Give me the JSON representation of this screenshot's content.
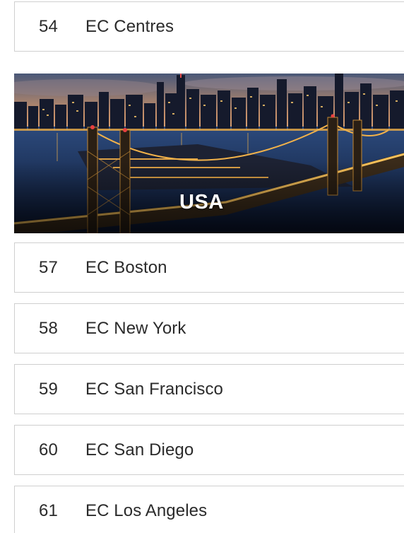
{
  "sections": [
    {
      "number": "54",
      "title": "EC Centres"
    },
    {
      "number": "57",
      "title": "EC Boston"
    },
    {
      "number": "58",
      "title": "EC New York"
    },
    {
      "number": "59",
      "title": "EC San Francisco"
    },
    {
      "number": "60",
      "title": "EC San Diego"
    },
    {
      "number": "61",
      "title": "EC Los Angeles"
    }
  ],
  "banner": {
    "label": "USA",
    "image_subject": "new-york-city-skyline-bridge-night"
  },
  "colors": {
    "row_border": "#cfcfcf",
    "text": "#2b2b2b",
    "banner_text": "#ffffff",
    "city_lights": "#f4b24a"
  }
}
